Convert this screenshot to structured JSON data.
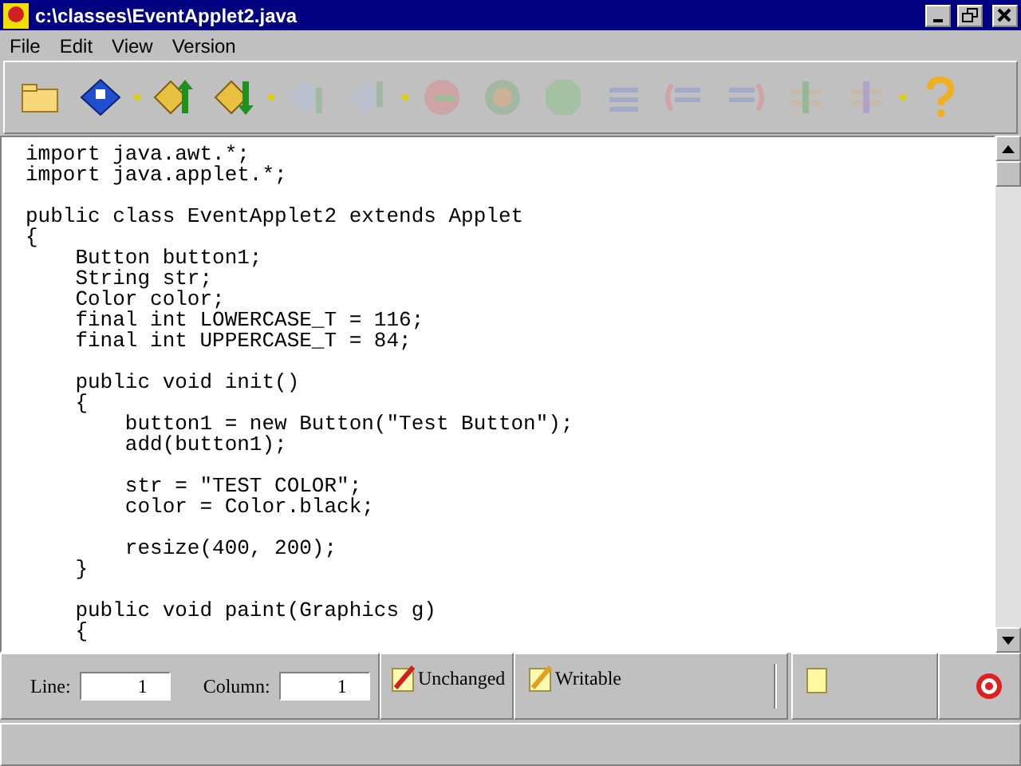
{
  "window": {
    "title": "c:\\classes\\EventApplet2.java"
  },
  "menu": [
    "File",
    "Edit",
    "View",
    "Version"
  ],
  "toolbar": [
    {
      "kind": "button",
      "disabled": false
    },
    {
      "kind": "button",
      "disabled": false
    },
    {
      "kind": "separator"
    },
    {
      "kind": "button",
      "disabled": false
    },
    {
      "kind": "button",
      "disabled": false
    },
    {
      "kind": "separator"
    },
    {
      "kind": "button",
      "disabled": true
    },
    {
      "kind": "button",
      "disabled": true
    },
    {
      "kind": "separator"
    },
    {
      "kind": "button",
      "disabled": true
    },
    {
      "kind": "button",
      "disabled": true
    },
    {
      "kind": "button",
      "disabled": true
    },
    {
      "kind": "button",
      "disabled": true
    },
    {
      "kind": "button",
      "disabled": true
    },
    {
      "kind": "button",
      "disabled": true
    },
    {
      "kind": "button",
      "disabled": true
    },
    {
      "kind": "button",
      "disabled": true
    },
    {
      "kind": "separator"
    },
    {
      "kind": "button",
      "disabled": false
    }
  ],
  "code": [
    [
      "import java.awt.*;",
      "import java.applet.*;"
    ],
    [
      "public class EventApplet2 extends Applet",
      "{",
      "    Button button1;",
      "    String str;",
      "    Color color;",
      "    final int LOWERCASE_T = 116;",
      "    final int UPPERCASE_T = 84;"
    ],
    [
      "    public void init()",
      "    {",
      "        button1 = new Button(\"Test Button\");",
      "        add(button1);"
    ],
    [
      "        str = \"TEST COLOR\";",
      "        color = Color.black;"
    ],
    [
      "        resize(400, 200);",
      "    }"
    ],
    [
      "    public void paint(Graphics g)",
      "    {"
    ]
  ],
  "status": {
    "line_label": "Line:",
    "line_value": "1",
    "column_label": "Column:",
    "column_value": "1",
    "modified": "Unchanged",
    "access": "Writable"
  }
}
